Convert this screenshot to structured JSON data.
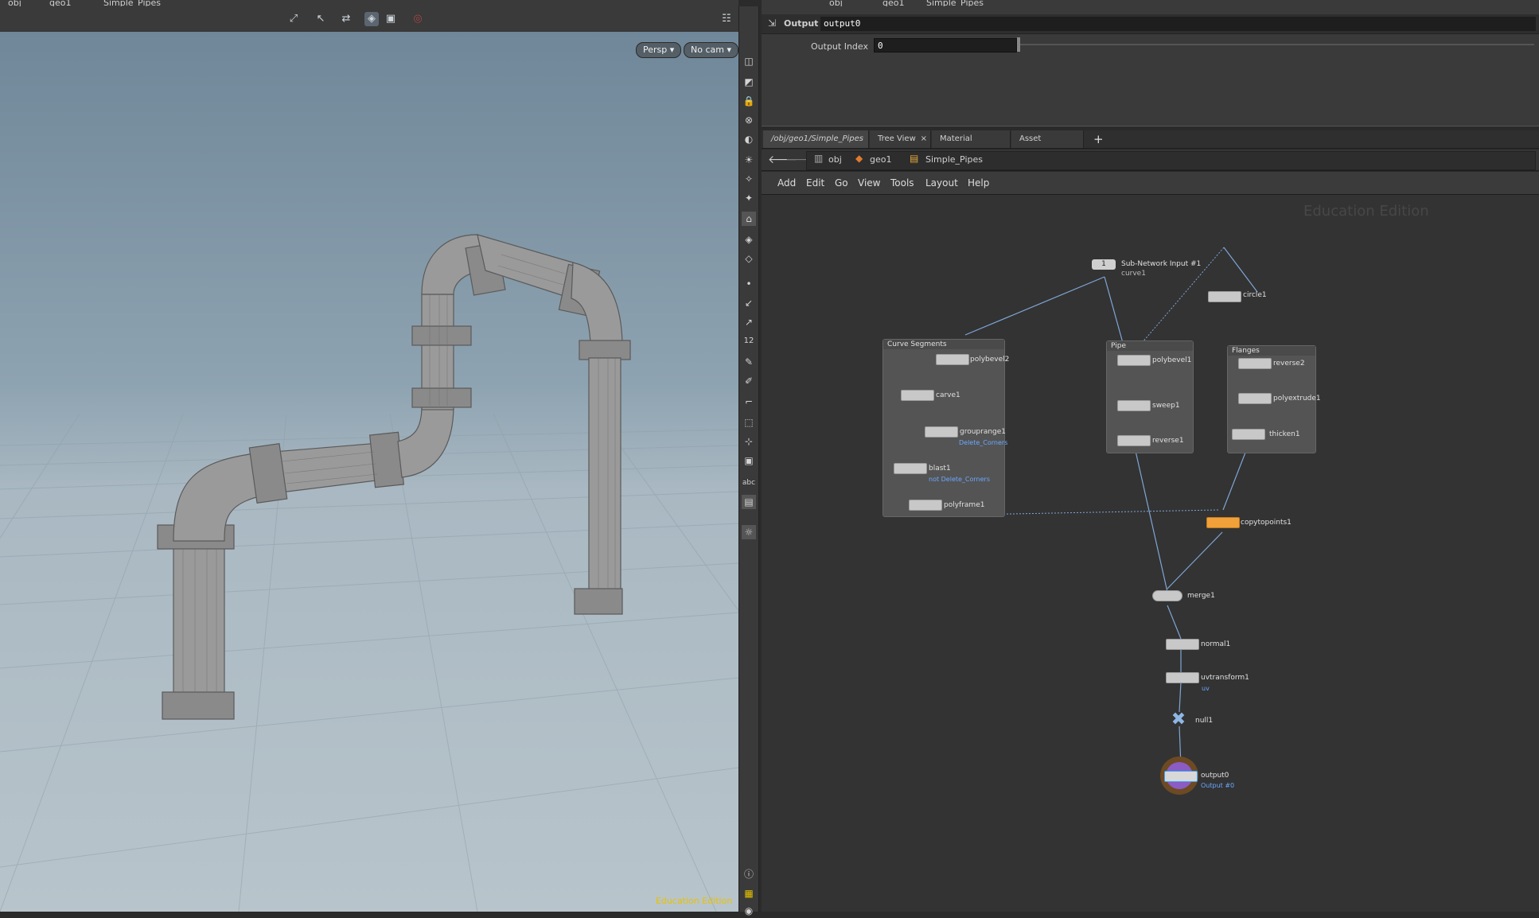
{
  "viewport_tab": {
    "crumb_obj": "obj",
    "crumb_geo": "geo1",
    "crumb_net": "Simple_Pipes"
  },
  "viewport": {
    "persp_label": "Persp",
    "cam_label": "No cam",
    "watermark": "Education Edition"
  },
  "params_tab": {
    "crumb_obj": "obj",
    "crumb_geo": "geo1",
    "crumb_net": "Simple_Pipes"
  },
  "params": {
    "node_type": "Output",
    "node_name": "output0",
    "output_index_label": "Output Index",
    "output_index_value": "0"
  },
  "network_tabs": [
    {
      "label": "/obj/geo1/Simple_Pipes"
    },
    {
      "label": "Tree View"
    },
    {
      "label": "Material Palette"
    },
    {
      "label": "Asset Browser"
    }
  ],
  "network_path": {
    "obj": "obj",
    "geo": "geo1",
    "net": "Simple_Pipes"
  },
  "network_menu": [
    "Add",
    "Edit",
    "Go",
    "View",
    "Tools",
    "Layout",
    "Help"
  ],
  "network": {
    "watermark": "Education Edition",
    "subnet_input": {
      "number": "1",
      "label": "Sub-Network Input #1",
      "sub": "curve1"
    },
    "boxes": {
      "curve_segments": "Curve Segments",
      "pipe": "Pipe",
      "flanges": "Flanges"
    },
    "nodes": {
      "polybevel2": "polybevel2",
      "carve1": "carve1",
      "grouprange1": "grouprange1",
      "grouprange1_sub": "Delete_Corners",
      "blast1": "blast1",
      "blast1_sub": "not Delete_Corners",
      "polyframe1": "polyframe1",
      "polybevel1": "polybevel1",
      "sweep1": "sweep1",
      "reverse1": "reverse1",
      "circle1": "circle1",
      "reverse2": "reverse2",
      "polyextrude1": "polyextrude1",
      "thicken1": "thicken1",
      "copytopoints1": "copytopoints1",
      "merge1": "merge1",
      "normal1": "normal1",
      "uvtransform1": "uvtransform1",
      "uvtransform1_sub": "uv",
      "null1": "null1",
      "output0": "output0",
      "output0_sub": "Output #0"
    }
  },
  "colors": {
    "accent_orange": "#f0a13a",
    "wire": "#7fa6d6",
    "output_ring": "#9b6a2e"
  }
}
